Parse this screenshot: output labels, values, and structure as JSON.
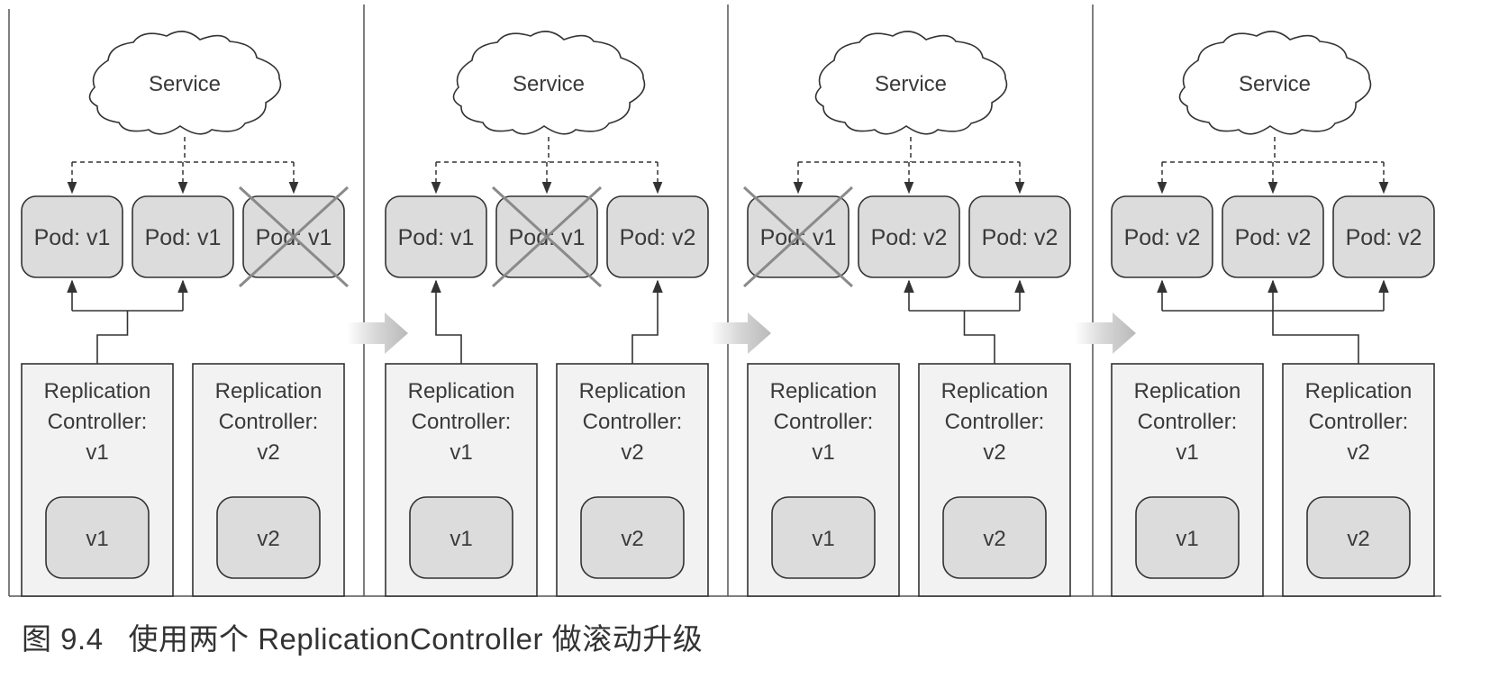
{
  "figure": {
    "caption_number": "图 9.4",
    "caption_text": "使用两个 ReplicationController 做滚动升级"
  },
  "colors": {
    "pod_fill": "#dcdcdc",
    "rc_fill": "#f2f2f2",
    "line": "#333333",
    "cross": "#8a8a8a",
    "arrow": "#c8c8c8"
  },
  "stages": [
    {
      "service": "Service",
      "pods": [
        {
          "label": "Pod: v1",
          "removed": false
        },
        {
          "label": "Pod: v1",
          "removed": false
        },
        {
          "label": "Pod: v1",
          "removed": true
        }
      ],
      "controllers": [
        {
          "label": "Replication Controller: v1",
          "template": "v1"
        },
        {
          "label": "Replication Controller: v2",
          "template": "v2"
        }
      ]
    },
    {
      "service": "Service",
      "pods": [
        {
          "label": "Pod: v1",
          "removed": false
        },
        {
          "label": "Pod: v1",
          "removed": true
        },
        {
          "label": "Pod: v2",
          "removed": false
        }
      ],
      "controllers": [
        {
          "label": "Replication Controller: v1",
          "template": "v1"
        },
        {
          "label": "Replication Controller: v2",
          "template": "v2"
        }
      ]
    },
    {
      "service": "Service",
      "pods": [
        {
          "label": "Pod: v1",
          "removed": true
        },
        {
          "label": "Pod: v2",
          "removed": false
        },
        {
          "label": "Pod: v2",
          "removed": false
        }
      ],
      "controllers": [
        {
          "label": "Replication Controller: v1",
          "template": "v1"
        },
        {
          "label": "Replication Controller: v2",
          "template": "v2"
        }
      ]
    },
    {
      "service": "Service",
      "pods": [
        {
          "label": "Pod: v2",
          "removed": false
        },
        {
          "label": "Pod: v2",
          "removed": false
        },
        {
          "label": "Pod: v2",
          "removed": false
        }
      ],
      "controllers": [
        {
          "label": "Replication Controller: v1",
          "template": "v1"
        },
        {
          "label": "Replication Controller: v2",
          "template": "v2"
        }
      ]
    }
  ]
}
